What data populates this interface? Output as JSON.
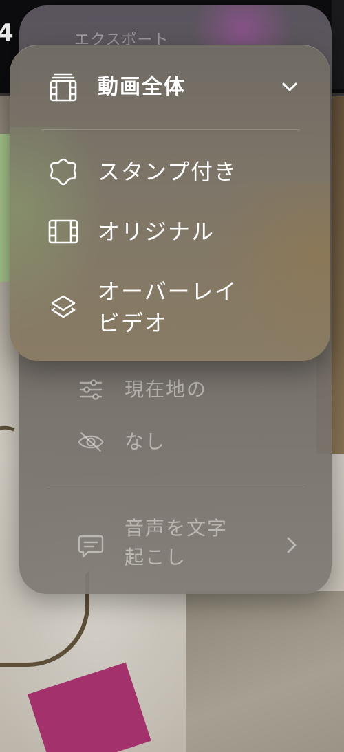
{
  "background": {
    "corner_text": "4"
  },
  "rear_menu": {
    "title": "エクスポート",
    "items": [
      {
        "label": "現在地の",
        "icon": "sliders-icon"
      },
      {
        "label": "なし",
        "icon": "eye-slash-icon"
      },
      {
        "label": "音声を文字\n起こし",
        "icon": "speech-bubble-icon",
        "has_submenu": true
      }
    ]
  },
  "front_menu": {
    "header": {
      "label": "動画全体",
      "icon": "stacked-film-icon",
      "chevron": "chevron-down-icon"
    },
    "options": [
      {
        "label": "スタンプ付き",
        "icon": "sticker-badge-icon"
      },
      {
        "label": "オリジナル",
        "icon": "film-icon"
      },
      {
        "label": "オーバーレイ\nビデオ",
        "icon": "layers-icon"
      }
    ]
  },
  "colors": {
    "text_primary": "#ffffff",
    "text_dimmed": "#ebe8e4",
    "menu_glass": "#776f65"
  }
}
